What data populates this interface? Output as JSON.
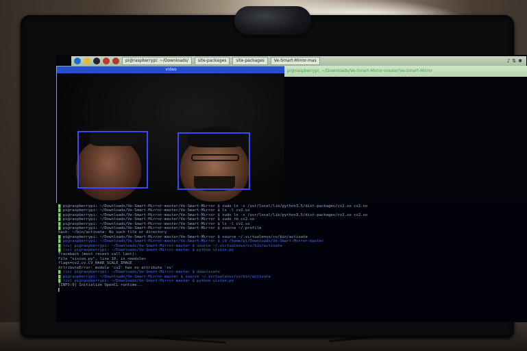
{
  "taskbar": {
    "tasks": [
      "pi@raspberrypi: ~/Downloads/",
      "site-packages",
      "site-packages",
      "Ve-Smart-Mirror-mas"
    ],
    "tray_icons": [
      "volume-icon",
      "network-icon",
      "bluetooth-icon"
    ]
  },
  "camera_window": {
    "title": "video"
  },
  "terminal": {
    "header": "pi@raspberrypi: ~/Downloads/Ve-Smart-Mirror-master/Ve-Smart-Mirror",
    "lines": [
      "pi@raspberrypi: ~/Downloads/Ve-Smart-Mirror-master/Ve-Smart-Mirror $ sudo ln -s /usr/local/lib/python3.5/dist-packages/cv2.so cv2.so",
      "pi@raspberrypi: ~/Downloads/Ve-Smart-Mirror-master/Ve-Smart-Mirror $ ls -l cv2.so",
      "pi@raspberrypi: ~/Downloads/Ve-Smart-Mirror-master/Ve-Smart-Mirror $ sudo ln -s /usr/local/lib/python3.5/dist-packages/cv2.so cv2.so",
      "pi@raspberrypi: ~/Downloads/Ve-Smart-Mirror-master/Ve-Smart-Mirror $ sudo rm cv2.so",
      "pi@raspberrypi: ~/Downloads/Ve-Smart-Mirror-master/Ve-Smart-Mirror $ ls -l cv2.so",
      "pi@raspberrypi: ~/Downloads/Ve-Smart-Mirror-master/Ve-Smart-Mirror $ source ~/.profile",
      "bash: ~/bin/activate: No such file or directory",
      "pi@raspberrypi: ~/Downloads/Ve-Smart-Mirror-master/Ve-Smart-Mirror $ source ~/.virtualenvs/cv/bin/activate",
      "pi@raspberrypi: ~/Downloads/Ve-Smart-Mirror-master/Ve-Smart-Mirror $ cd /home/pi/Downloads/Ve-Smart-Mirror-master",
      "(cv) pi@raspberrypi: ~/Downloads/Ve-Smart-Mirror-master $ source ~/.virtualenvs/cv/bin/activate",
      "(cv) pi@raspberrypi: ~/Downloads/Ve-Smart-Mirror-master $ python vision.py",
      "Traceback (most recent call last):",
      "  File \"vision.py\", line 10, in <module>",
      "    flags=cv2.cv.CV_HAAR_SCALE_IMAGE",
      "AttributeError: module 'cv2' has no attribute 'cv'",
      "(cv) pi@raspberrypi: ~/Downloads/Ve-Smart-Mirror-master $ deactivate",
      "pi@raspberrypi: ~/Downloads/Ve-Smart-Mirror-master $ source ~/.virtualenvs/cv/bin/activate",
      "(cv) pi@raspberrypi: ~/Downloads/Ve-Smart-Mirror-master $ python vision.py",
      "[INFO:0] Initialize OpenCL runtime..."
    ]
  },
  "colors": {
    "prompt": "#6ee04a",
    "path": "#3c6cff",
    "face_box": "#3a48ff",
    "camera_title_bar": "#2450d0"
  }
}
